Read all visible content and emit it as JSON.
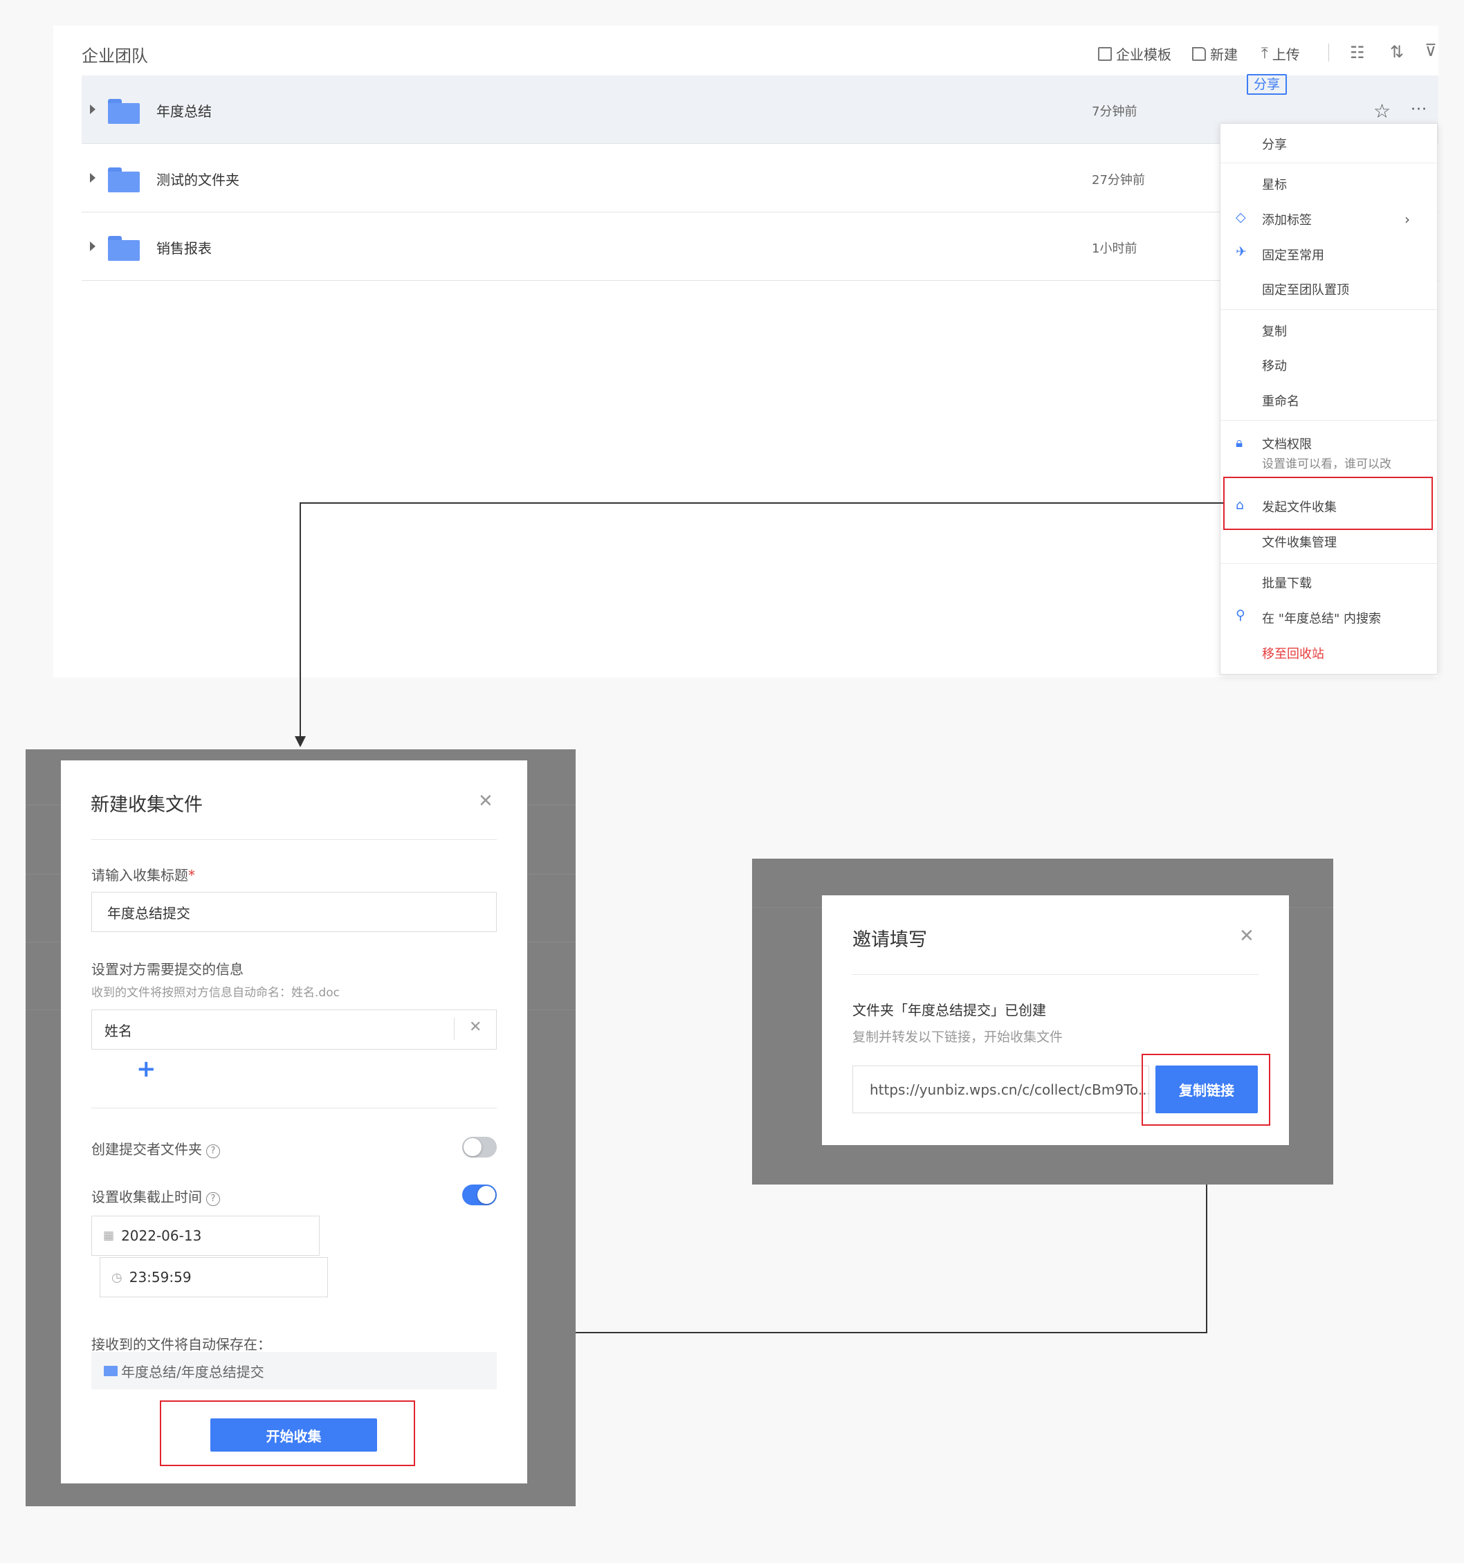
{
  "file_panel": {
    "title": "企业团队",
    "toolbar": {
      "template_label": "企业模板",
      "new_label": "新建",
      "upload_label": "上传"
    },
    "rows": [
      {
        "name": "年度总结",
        "time": "7分钟前"
      },
      {
        "name": "测试的文件夹",
        "time": "27分钟前"
      },
      {
        "name": "销售报表",
        "time": "1小时前"
      }
    ],
    "share_label": "分享"
  },
  "context_menu": {
    "items": {
      "share": "分享",
      "star": "星标",
      "add_tag": "添加标签",
      "pin_common": "固定至常用",
      "pin_team_top": "固定至团队置顶",
      "copy": "复制",
      "move": "移动",
      "rename": "重命名",
      "permissions": "文档权限",
      "permissions_sub": "设置谁可以看，谁可以改",
      "start_collect": "发起文件收集",
      "collect_manage": "文件收集管理",
      "batch_download": "批量下载",
      "search_in": "在 \"年度总结\" 内搜索",
      "move_to_trash": "移至回收站"
    },
    "highlighted_item": "发起文件收集"
  },
  "new_collect_modal": {
    "title": "新建收集文件",
    "title_label": "请输入收集标题",
    "required_mark": "*",
    "title_value": "年度总结提交",
    "info_label": "设置对方需要提交的信息",
    "info_hint": "收到的文件将按照对方信息自动命名：姓名.doc",
    "info_field_value": "姓名",
    "add_symbol": "+",
    "create_folder_label": "创建提交者文件夹",
    "create_folder_on": false,
    "deadline_label": "设置收集截止时间",
    "deadline_on": true,
    "help_symbol": "?",
    "date_value": "2022-06-13",
    "time_value": "23:59:59",
    "save_location_label": "接收到的文件将自动保存在：",
    "save_path": "年度总结/年度总结提交",
    "start_button": "开始收集"
  },
  "invite_modal": {
    "title": "邀请填写",
    "created_text": "文件夹「年度总结提交」已创建",
    "hint": "复制并转发以下链接，开始收集文件",
    "link": "https://yunbiz.wps.cn/c/collect/cBm9To...",
    "copy_button": "复制链接"
  },
  "colors": {
    "accent": "#3d7df5",
    "highlight_box": "#e0242e",
    "danger_text": "#e53b3b",
    "overlay": "#808080"
  }
}
